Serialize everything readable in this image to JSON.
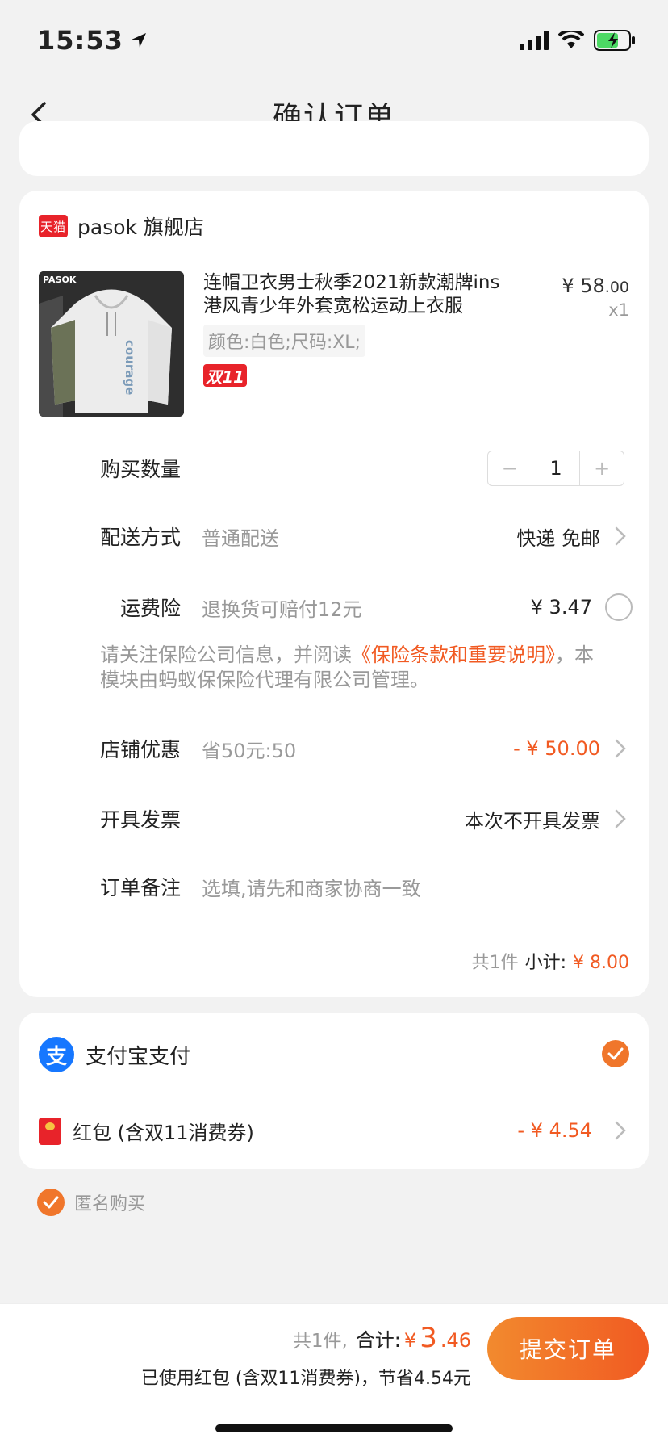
{
  "status_bar": {
    "time": "15:53"
  },
  "nav": {
    "title": "确认订单"
  },
  "store": {
    "badge": "天猫",
    "name": "pasok 旗舰店"
  },
  "product": {
    "title": "连帽卫衣男士秋季2021新款潮牌ins港风青少年外套宽松运动上衣服",
    "price_main": "¥ 58",
    "price_decimal": ".00",
    "quantity": "x1",
    "spec": "颜色:白色;尺码:XL;",
    "tag": "双11",
    "image_brand": "PASOK",
    "image_print": "courage"
  },
  "purchase_qty": {
    "label": "购买数量",
    "minus": "−",
    "value": "1",
    "plus": "+"
  },
  "delivery": {
    "label": "配送方式",
    "desc": "普通配送",
    "value": "快递 免邮"
  },
  "insurance": {
    "label": "运费险",
    "desc": "退换货可赔付12元",
    "value": "¥ 3.47",
    "note_prefix": "请关注保险公司信息，并阅读",
    "note_link": "《保险条款和重要说明》",
    "note_suffix": "，本模块由蚂蚁保保险代理有限公司管理。"
  },
  "store_discount": {
    "label": "店铺优惠",
    "desc": "省50元:50",
    "value": "- ¥ 50.00"
  },
  "invoice": {
    "label": "开具发票",
    "value": "本次不开具发票"
  },
  "remark": {
    "label": "订单备注",
    "placeholder": "选填,请先和商家协商一致"
  },
  "subtotal": {
    "count": "共1件",
    "label": "小计:",
    "value": "¥ 8.00"
  },
  "payment": {
    "alipay_label": "支付宝支付",
    "alipay_glyph": "支",
    "redpacket_label": "红包 (含双11消费券)",
    "redpacket_value": "- ¥ 4.54"
  },
  "anonymous": {
    "label": "匿名购买"
  },
  "bottom": {
    "count": "共1件,",
    "total_label": "合计:",
    "currency": "¥",
    "total_int": "3",
    "total_dec": ".46",
    "saving": "已使用红包 (含双11消费券)，节省4.54元",
    "submit": "提交订单"
  },
  "colors": {
    "accent": "#f15a22",
    "alipay": "#1677ff",
    "tmall": "#e8232a"
  }
}
